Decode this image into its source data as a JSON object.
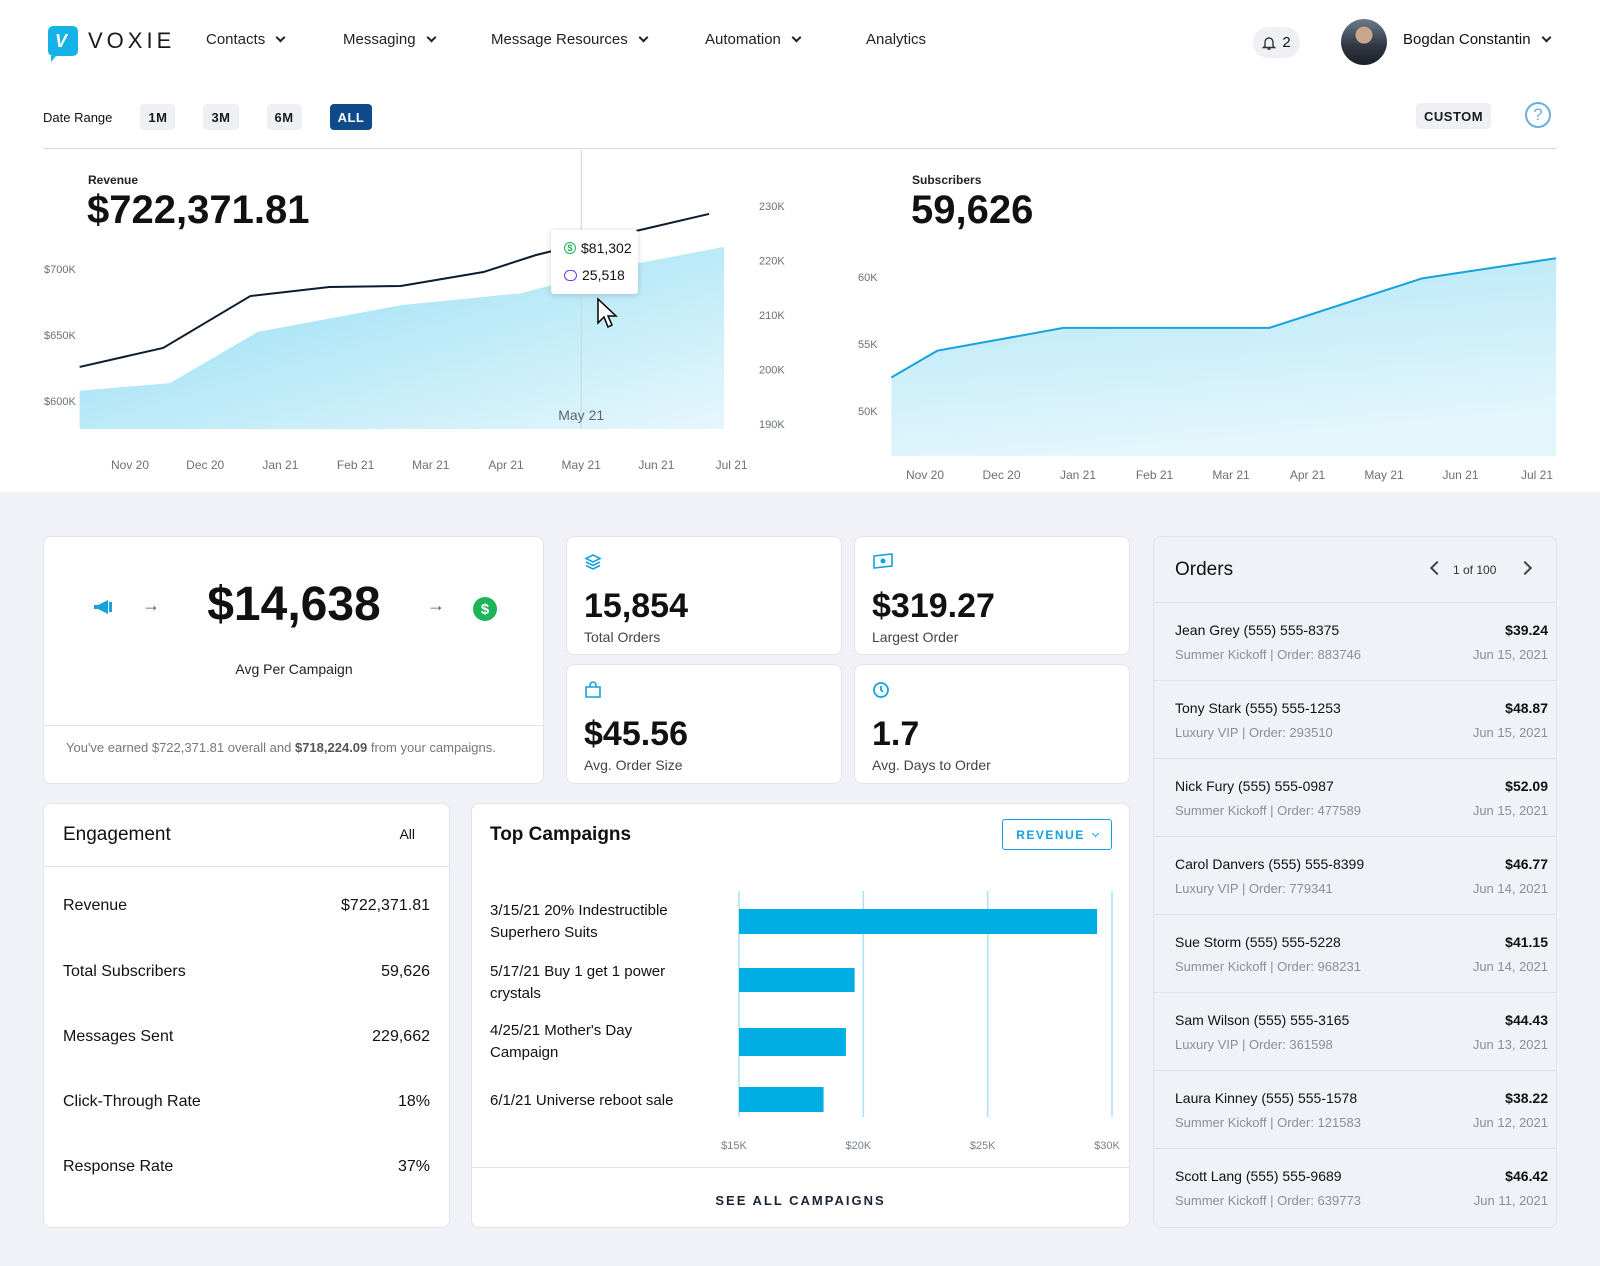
{
  "app": {
    "brand": "VOXIE",
    "nav": [
      {
        "label": "Contacts",
        "dropdown": true
      },
      {
        "label": "Messaging",
        "dropdown": true
      },
      {
        "label": "Message Resources",
        "dropdown": true
      },
      {
        "label": "Automation",
        "dropdown": true
      },
      {
        "label": "Analytics",
        "dropdown": false
      }
    ],
    "notifications_count": "2",
    "user_name": "Bogdan Constantin"
  },
  "date_range": {
    "label": "Date Range",
    "options": [
      "1M",
      "3M",
      "6M",
      "ALL"
    ],
    "selected": "ALL",
    "custom_label": "CUSTOM",
    "help_label": "?"
  },
  "colors": {
    "accent": "#14b2e6",
    "bar": "#00aee4",
    "active_pill": "#0f4a8a",
    "revenue_line": "#0d1b2e",
    "success": "#1fb35a",
    "message": "#6b3fe0"
  },
  "revenue_chart": {
    "label": "Revenue",
    "value": "$722,371.81",
    "tooltip": {
      "revenue": "$81,302",
      "messages": "25,518",
      "month": "May 21"
    }
  },
  "subscribers_chart": {
    "label": "Subscribers",
    "value": "59,626"
  },
  "chart_data": [
    {
      "type": "line",
      "title": "Revenue",
      "x_ticks": [
        "Nov 20",
        "Dec 20",
        "Jan 21",
        "Feb 21",
        "Mar 21",
        "Apr 21",
        "May 21",
        "Jun 21",
        "Jul 21"
      ],
      "y_left_ticks": [
        "$600K",
        "$650K",
        "$700K"
      ],
      "y_left_range": [
        600000,
        700000
      ],
      "y_right_ticks": [
        "190K",
        "200K",
        "210K",
        "220K",
        "230K"
      ],
      "y_right_range": [
        190000,
        230000
      ],
      "series": [
        {
          "name": "Revenue",
          "axis": "left",
          "kind": "line",
          "x": [
            -0.67,
            0.44,
            1.6,
            2.65,
            3.6,
            4.7,
            5.4,
            6.5,
            7.7
          ],
          "values": [
            625800,
            640200,
            679500,
            686400,
            687100,
            697700,
            710600,
            725800,
            741700
          ]
        },
        {
          "name": "Messages",
          "axis": "right",
          "kind": "area",
          "x": [
            -0.67,
            0.53,
            1.7,
            3.6,
            5.2,
            6.5,
            7.9
          ],
          "values": [
            196100,
            197500,
            206900,
            211800,
            214000,
            218800,
            222500
          ]
        }
      ],
      "hover": {
        "x": 6,
        "label": "May 21"
      }
    },
    {
      "type": "area",
      "title": "Subscribers",
      "x_ticks": [
        "Nov 20",
        "Dec 20",
        "Jan 21",
        "Feb 21",
        "Mar 21",
        "Apr 21",
        "May 21",
        "Jun 21",
        "Jul 21"
      ],
      "y_ticks": [
        "50K",
        "55K",
        "60K"
      ],
      "y_range": [
        50000,
        60000
      ],
      "series": [
        {
          "name": "Subscribers",
          "x": [
            -0.44,
            0.16,
            1.81,
            4.5,
            6.5,
            8.25
          ],
          "values": [
            52500,
            54500,
            56200,
            56200,
            59900,
            61400
          ]
        }
      ]
    },
    {
      "type": "bar",
      "title": "Top Campaigns",
      "categories": [
        "3/15/21 20% Indestructible Superhero Suits",
        "5/17/21 Buy 1 get 1 power crystals",
        "4/25/21 Mother's Day Campaign",
        "6/1/21 Universe reboot sale"
      ],
      "values": [
        29400,
        19650,
        19300,
        18400
      ],
      "x_ticks": [
        "$15K",
        "$20K",
        "$25K",
        "$30K"
      ],
      "x_range": [
        15000,
        30000
      ],
      "grid": true
    }
  ],
  "avg_campaign": {
    "value": "$14,638",
    "label": "Avg Per Campaign",
    "footer_pre": "You've earned $722,371.81 overall and ",
    "footer_bold": "$718,224.09",
    "footer_post": " from your campaigns."
  },
  "stats": [
    {
      "icon": "layers-icon",
      "value": "15,854",
      "label": "Total Orders"
    },
    {
      "icon": "cash-icon",
      "value": "$319.27",
      "label": "Largest Order"
    },
    {
      "icon": "shopping-bag-icon",
      "value": "$45.56",
      "label": "Avg. Order Size"
    },
    {
      "icon": "clock-icon",
      "value": "1.7",
      "label": "Avg. Days to Order"
    }
  ],
  "engagement": {
    "title": "Engagement",
    "filter": "All",
    "rows": [
      {
        "label": "Revenue",
        "value": "$722,371.81"
      },
      {
        "label": "Total Subscribers",
        "value": "59,626"
      },
      {
        "label": "Messages Sent",
        "value": "229,662"
      },
      {
        "label": "Click-Through Rate",
        "value": "18%"
      },
      {
        "label": "Response Rate",
        "value": "37%"
      }
    ]
  },
  "top_campaigns": {
    "title": "Top Campaigns",
    "metric_select": "REVENUE",
    "campaign_lines": [
      [
        "3/15/21 20% Indestructible",
        "Superhero Suits"
      ],
      [
        "5/17/21 Buy 1 get 1 power",
        "crystals"
      ],
      [
        "4/25/21 Mother's Day",
        "Campaign"
      ],
      [
        "6/1/21 Universe reboot sale"
      ]
    ],
    "see_all": "SEE ALL CAMPAIGNS"
  },
  "orders": {
    "title": "Orders",
    "pager": "1 of 100",
    "rows": [
      {
        "name": "Jean Grey (555) 555-8375",
        "meta": "Summer Kickoff | Order: 883746",
        "amount": "$39.24",
        "date": "Jun 15, 2021"
      },
      {
        "name": "Tony Stark (555) 555-1253",
        "meta": "Luxury VIP | Order: 293510",
        "amount": "$48.87",
        "date": "Jun 15, 2021"
      },
      {
        "name": "Nick Fury (555) 555-0987",
        "meta": "Summer Kickoff | Order: 477589",
        "amount": "$52.09",
        "date": "Jun 15, 2021"
      },
      {
        "name": "Carol Danvers (555) 555-8399",
        "meta": "Luxury VIP | Order: 779341",
        "amount": "$46.77",
        "date": "Jun 14, 2021"
      },
      {
        "name": "Sue Storm (555) 555-5228",
        "meta": "Summer Kickoff | Order: 968231",
        "amount": "$41.15",
        "date": "Jun 14, 2021"
      },
      {
        "name": "Sam Wilson (555) 555-3165",
        "meta": "Luxury VIP | Order: 361598",
        "amount": "$44.43",
        "date": "Jun 13, 2021"
      },
      {
        "name": "Laura Kinney (555) 555-1578",
        "meta": "Summer Kickoff | Order: 121583",
        "amount": "$38.22",
        "date": "Jun 12, 2021"
      },
      {
        "name": "Scott Lang (555) 555-9689",
        "meta": "Summer Kickoff | Order: 639773",
        "amount": "$46.42",
        "date": "Jun 11, 2021"
      }
    ]
  }
}
